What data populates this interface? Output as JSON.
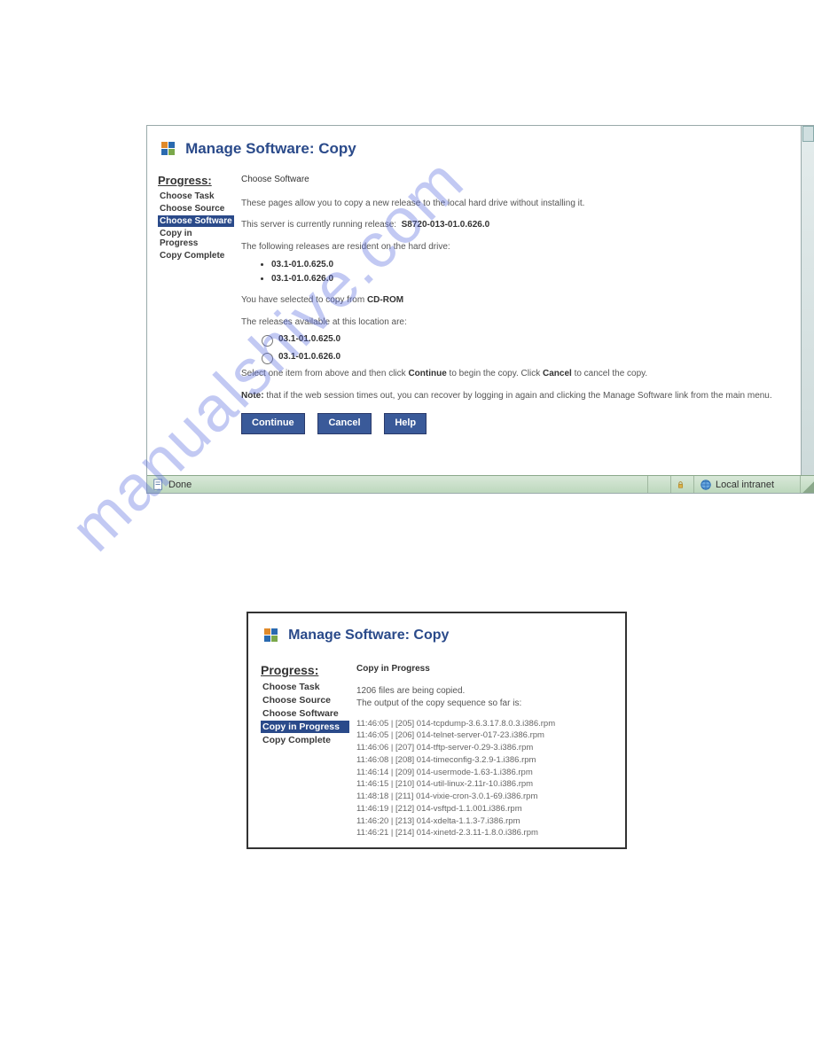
{
  "watermark": "manualshive.com",
  "w1": {
    "title": "Manage Software: Copy",
    "sidebar": {
      "heading": "Progress:",
      "steps": [
        {
          "label": "Choose Task",
          "active": false
        },
        {
          "label": "Choose Source",
          "active": false
        },
        {
          "label": "Choose Software",
          "active": true
        },
        {
          "label": "Copy in Progress",
          "active": false
        },
        {
          "label": "Copy Complete",
          "active": false
        }
      ]
    },
    "main": {
      "section_title": "Choose Software",
      "intro": "These pages allow you to copy a new release to the local hard drive without installing it.",
      "running_prefix": "This server is currently running release:",
      "running_release": "S8720-013-01.0.626.0",
      "resident_line": "The following releases are resident on the hard drive:",
      "resident_list": [
        "03.1-01.0.625.0",
        "03.1-01.0.626.0"
      ],
      "selected_prefix": "You have selected to copy from",
      "selected_source": "CD-ROM",
      "available_line": "The releases available at this location are:",
      "options": [
        "03.1-01.0.625.0",
        "03.1-01.0.626.0"
      ],
      "instruction_a": "Select one item from above and then click",
      "instruction_b": "Continue",
      "instruction_c": "to begin the copy. Click",
      "instruction_d": "Cancel",
      "instruction_e": "to cancel the copy.",
      "note_label": "Note:",
      "note_body": "that if the web session times out, you can recover by logging in again and clicking the Manage Software link from the main menu.",
      "btn_continue": "Continue",
      "btn_cancel": "Cancel",
      "btn_help": "Help"
    },
    "status": {
      "done": "Done",
      "zone": "Local intranet"
    }
  },
  "w2": {
    "title": "Manage Software: Copy",
    "sidebar": {
      "heading": "Progress:",
      "steps": [
        {
          "label": "Choose Task",
          "active": false
        },
        {
          "label": "Choose Source",
          "active": false
        },
        {
          "label": "Choose Software",
          "active": false
        },
        {
          "label": "Copy in Progress",
          "active": true
        },
        {
          "label": "Copy Complete",
          "active": false
        }
      ]
    },
    "main": {
      "section_title": "Copy in Progress",
      "count_line": "1206 files are being copied.",
      "output_line": "The output of the copy sequence so far is:",
      "log": [
        "11:46:05 | [205] 014-tcpdump-3.6.3.17.8.0.3.i386.rpm",
        "11:46:05 | [206] 014-telnet-server-017-23.i386.rpm",
        "11:46:06 | [207] 014-tftp-server-0.29-3.i386.rpm",
        "11:46:08 | [208] 014-timeconfig-3.2.9-1.i386.rpm",
        "11:46:14 | [209] 014-usermode-1.63-1.i386.rpm",
        "11:46:15 | [210] 014-util-linux-2.11r-10.i386.rpm",
        "11:48:18 | [211] 014-vixie-cron-3.0.1-69.i386.rpm",
        "11:46:19 | [212] 014-vsftpd-1.1.001.i386.rpm",
        "11:46:20 | [213] 014-xdelta-1.1.3-7.i386.rpm",
        "11:46:21 | [214] 014-xinetd-2.3.11-1.8.0.i386.rpm"
      ]
    }
  }
}
